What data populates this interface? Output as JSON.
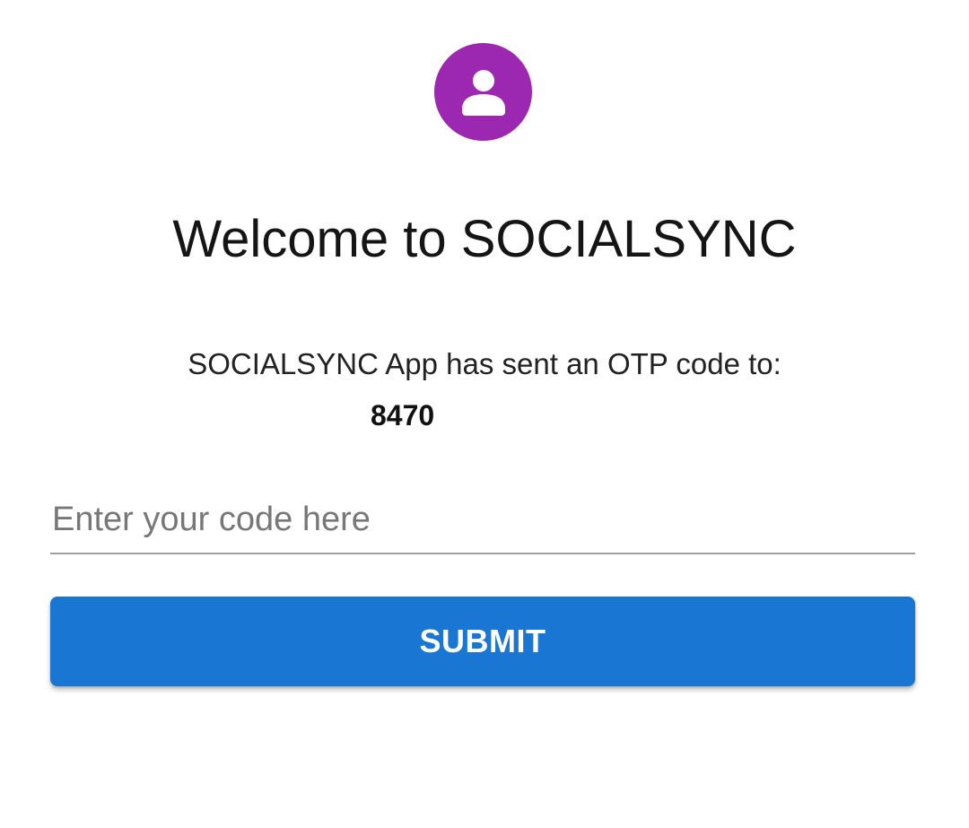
{
  "avatar": {
    "icon": "person-icon",
    "color": "#9c27b0"
  },
  "header": {
    "title": "Welcome to SOCIALSYNC"
  },
  "otp": {
    "message": "SOCIALSYNC App has sent an OTP code to:",
    "phone": "8470"
  },
  "form": {
    "code_placeholder": "Enter your code here",
    "code_value": "",
    "submit_label": "SUBMIT",
    "accent_color": "#1976d2"
  }
}
